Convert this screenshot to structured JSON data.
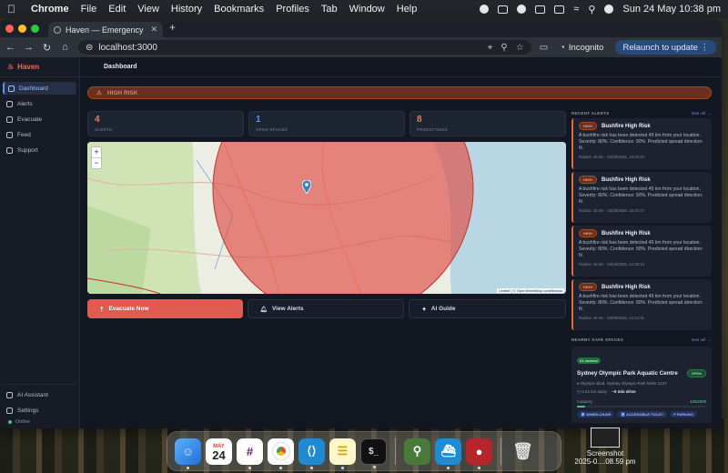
{
  "menubar": {
    "app": "Chrome",
    "items": [
      "File",
      "Edit",
      "View",
      "History",
      "Bookmarks",
      "Profiles",
      "Tab",
      "Window",
      "Help"
    ],
    "datetime": "Sun 24 May  10:38 pm"
  },
  "browser": {
    "tab_title": "Haven — Emergency Respons",
    "url": "localhost:3000",
    "incognito_label": "Incognito",
    "relaunch_label": "Relaunch to update"
  },
  "app": {
    "brand": "Haven",
    "page_title": "Dashboard",
    "nav": [
      {
        "label": "Dashboard",
        "icon": "grid-icon"
      },
      {
        "label": "Alerts",
        "icon": "bell-icon"
      },
      {
        "label": "Evacuate",
        "icon": "arrow-icon"
      },
      {
        "label": "Feed",
        "icon": "chat-icon"
      },
      {
        "label": "Support",
        "icon": "heart-icon"
      }
    ],
    "nav_bottom": [
      {
        "label": "AI Assistant",
        "icon": "sparkle-icon"
      },
      {
        "label": "Settings",
        "icon": "gear-icon"
      }
    ],
    "status": "Online",
    "risk_banner": "HIGH RISK",
    "stats": [
      {
        "value": "4",
        "label": "ALERTS",
        "color": "#f07a4a"
      },
      {
        "value": "1",
        "label": "OPEN SPACES",
        "color": "#5c8fff"
      },
      {
        "value": "8",
        "label": "PREDICTIONS",
        "color": "#f07a4a"
      }
    ],
    "map": {
      "zoom_in": "+",
      "zoom_out": "−",
      "attribution": "Leaflet | © OpenStreetMap contributors"
    },
    "actions": {
      "evacuate": "Evacuate Now",
      "view_alerts": "View Alerts",
      "ai_guide": "AI Guide"
    },
    "recent_alerts": {
      "heading": "RECENT ALERTS",
      "see_all": "See all →",
      "items": [
        {
          "badge": "HIGH",
          "title": "Bushfire High Risk",
          "body": "A bushfire risk has been detected 45 km from your location. Severity: 80%. Confidence: 90%. Predicted spread direction: N.",
          "meta": "Radius: 45 km · 24/05/2026, 16:10:34"
        },
        {
          "badge": "HIGH",
          "title": "Bushfire High Risk",
          "body": "A bushfire risk has been detected 45 km from your location. Severity: 80%. Confidence: 90%. Predicted spread direction: N.",
          "meta": "Radius: 45 km · 24/05/2026, 16:10:27"
        },
        {
          "badge": "HIGH",
          "title": "Bushfire High Risk",
          "body": "A bushfire risk has been detected 45 km from your location. Severity: 80%. Confidence: 90%. Predicted spread direction: N.",
          "meta": "Radius: 45 km · 24/05/2026, 14:28:13"
        },
        {
          "badge": "HIGH",
          "title": "Bushfire High Risk",
          "body": "A bushfire risk has been detected 45 km from your location. Severity: 80%. Confidence: 90%. Predicted spread direction: N.",
          "meta": "Radius: 45 km · 24/05/2026, 14:24:31"
        }
      ]
    },
    "safe_spaces": {
      "heading": "NEARBY SAFE SPACES",
      "see_all": "See all →",
      "nearest_badge": "#1 nearest",
      "name": "Sydney Olympic Park Aquatic Centre",
      "status": "OPEN",
      "address": "Olympic Blvd, Sydney Olympic Park NSW 2127",
      "distance": "0.42 km away",
      "drive": "~0 min drive",
      "capacity_label": "Capacity",
      "capacity_value": "120/2000",
      "capacity_fraction": 0.06,
      "tags": [
        "♿ WHEELCHAIR",
        "♿ ACCESSIBLE TOILET",
        "P PARKING"
      ]
    }
  },
  "desktop": {
    "dock_calendar_month": "MAY",
    "dock_calendar_day": "24",
    "screenshot_label_1": "Screenshot",
    "screenshot_label_2": "2025-0....08.59 pm"
  }
}
